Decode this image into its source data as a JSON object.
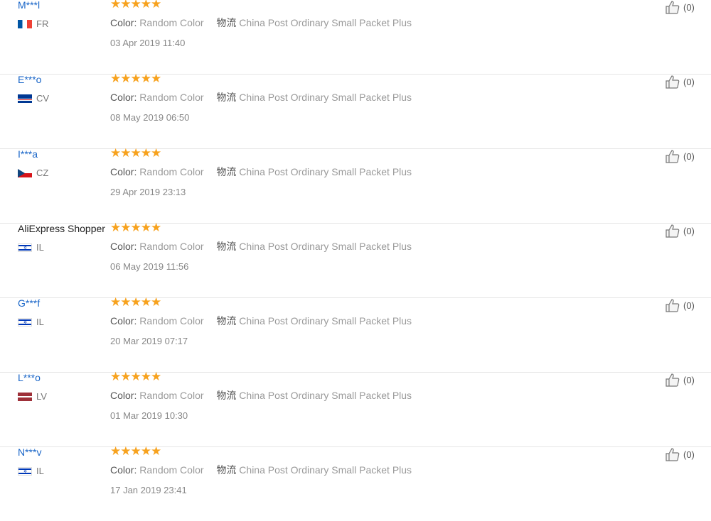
{
  "reviews": [
    {
      "name": "M***l",
      "country": "FR",
      "flag": "fr",
      "color_label": "Color:",
      "color_value": "Random Color",
      "shipping_label": "物流",
      "shipping_value": "China Post Ordinary Small Packet Plus",
      "date": "03 Apr 2019 11:40",
      "likes": "(0)",
      "rating": 5
    },
    {
      "name": "E***o",
      "country": "CV",
      "flag": "cv",
      "color_label": "Color:",
      "color_value": "Random Color",
      "shipping_label": "物流",
      "shipping_value": "China Post Ordinary Small Packet Plus",
      "date": "08 May 2019 06:50",
      "likes": "(0)",
      "rating": 5
    },
    {
      "name": "I***a",
      "country": "CZ",
      "flag": "cz",
      "color_label": "Color:",
      "color_value": "Random Color",
      "shipping_label": "物流",
      "shipping_value": "China Post Ordinary Small Packet Plus",
      "date": "29 Apr 2019 23:13",
      "likes": "(0)",
      "rating": 5
    },
    {
      "name": "AliExpress Shopper",
      "country": "IL",
      "flag": "il",
      "color_label": "Color:",
      "color_value": "Random Color",
      "shipping_label": "物流",
      "shipping_value": "China Post Ordinary Small Packet Plus",
      "date": "06 May 2019 11:56",
      "likes": "(0)",
      "rating": 5
    },
    {
      "name": "G***f",
      "country": "IL",
      "flag": "il",
      "color_label": "Color:",
      "color_value": "Random Color",
      "shipping_label": "物流",
      "shipping_value": "China Post Ordinary Small Packet Plus",
      "date": "20 Mar 2019 07:17",
      "likes": "(0)",
      "rating": 5
    },
    {
      "name": "L***o",
      "country": "LV",
      "flag": "lv",
      "color_label": "Color:",
      "color_value": "Random Color",
      "shipping_label": "物流",
      "shipping_value": "China Post Ordinary Small Packet Plus",
      "date": "01 Mar 2019 10:30",
      "likes": "(0)",
      "rating": 5
    },
    {
      "name": "N***v",
      "country": "IL",
      "flag": "il",
      "color_label": "Color:",
      "color_value": "Random Color",
      "shipping_label": "物流",
      "shipping_value": "China Post Ordinary Small Packet Plus",
      "date": "17 Jan 2019 23:41",
      "likes": "(0)",
      "rating": 5
    }
  ],
  "colors": {
    "star": "#f7a21e",
    "username": "#1a66c8"
  }
}
